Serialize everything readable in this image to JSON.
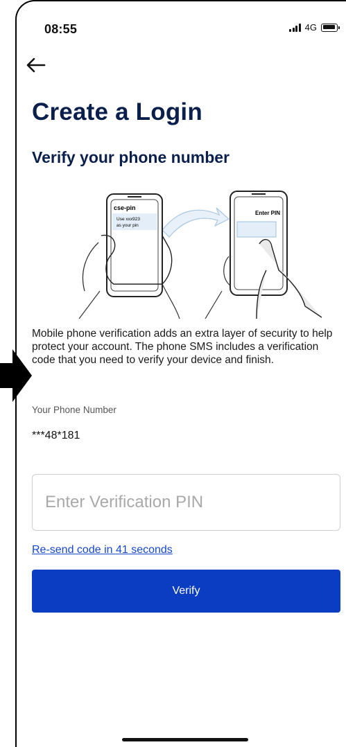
{
  "status_bar": {
    "time": "08:55",
    "network": "4G",
    "icons": [
      "signal-bars-icon",
      "battery-icon"
    ]
  },
  "header": {
    "back_icon": "arrow-left-icon",
    "title": "Create a Login",
    "subtitle": "Verify your phone number"
  },
  "illustration": {
    "left_phone_title": "cse-pin",
    "left_phone_message_line1": "Use xxx923",
    "left_phone_message_line2": "as your pin",
    "right_phone_title": "Enter PIN"
  },
  "description": "Mobile phone verification adds an extra layer of security to help protect your account. The phone SMS includes a verification code that you need to verify your device and finish.",
  "phone": {
    "label": "Your Phone Number",
    "value": "***48*181"
  },
  "pin_field": {
    "placeholder": "Enter Verification PIN",
    "value": ""
  },
  "resend_link": "Re-send code in 41 seconds",
  "verify_button": "Verify",
  "colors": {
    "title": "#0b1f4d",
    "primary_button": "#0a3dc2",
    "link": "#1648c9"
  }
}
